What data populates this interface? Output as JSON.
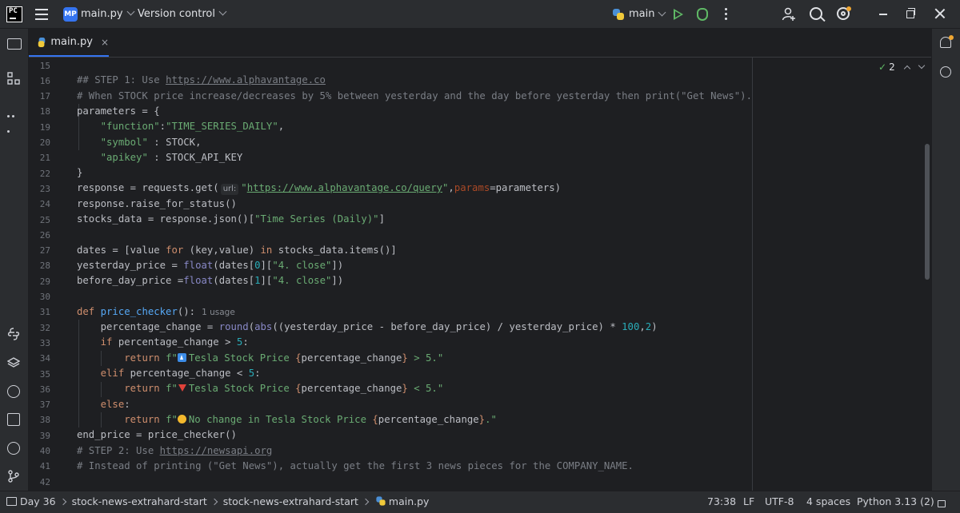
{
  "titlebar": {
    "project_badge": "MP",
    "project_name": "main.py",
    "version_control": "Version control",
    "run_config": "main"
  },
  "tab": {
    "label": "main.py",
    "close": "×"
  },
  "inspections": {
    "count": "2"
  },
  "editor": {
    "line_numbers": [
      "15",
      "16",
      "17",
      "18",
      "19",
      "20",
      "21",
      "22",
      "23",
      "24",
      "25",
      "26",
      "27",
      "28",
      "29",
      "30",
      "31",
      "32",
      "33",
      "34",
      "35",
      "36",
      "37",
      "38",
      "39",
      "40",
      "41",
      "42"
    ],
    "hint_url": "url:",
    "usage_hint": "1 usage"
  },
  "statusbar": {
    "crumb1": "Day 36",
    "crumb2": "stock-news-extrahard-start",
    "crumb3": "stock-news-extrahard-start",
    "crumb4": "main.py",
    "position": "73:38",
    "line_sep": "LF",
    "encoding": "UTF-8",
    "indent": "4 spaces",
    "interpreter": "Python 3.13 (2)"
  },
  "colors": {
    "accent": "#3574f0",
    "keyword": "#cf8e6d",
    "string": "#6aab73",
    "function": "#56a8f5",
    "comment": "#7a7e85",
    "number": "#2aacb8"
  },
  "icons": [
    "folder-icon",
    "structure-icon",
    "more-icon",
    "python-console-icon",
    "layers-icon",
    "services-icon",
    "terminal-icon",
    "problems-icon",
    "git-icon",
    "notifications-icon",
    "ai-assistant-icon"
  ]
}
